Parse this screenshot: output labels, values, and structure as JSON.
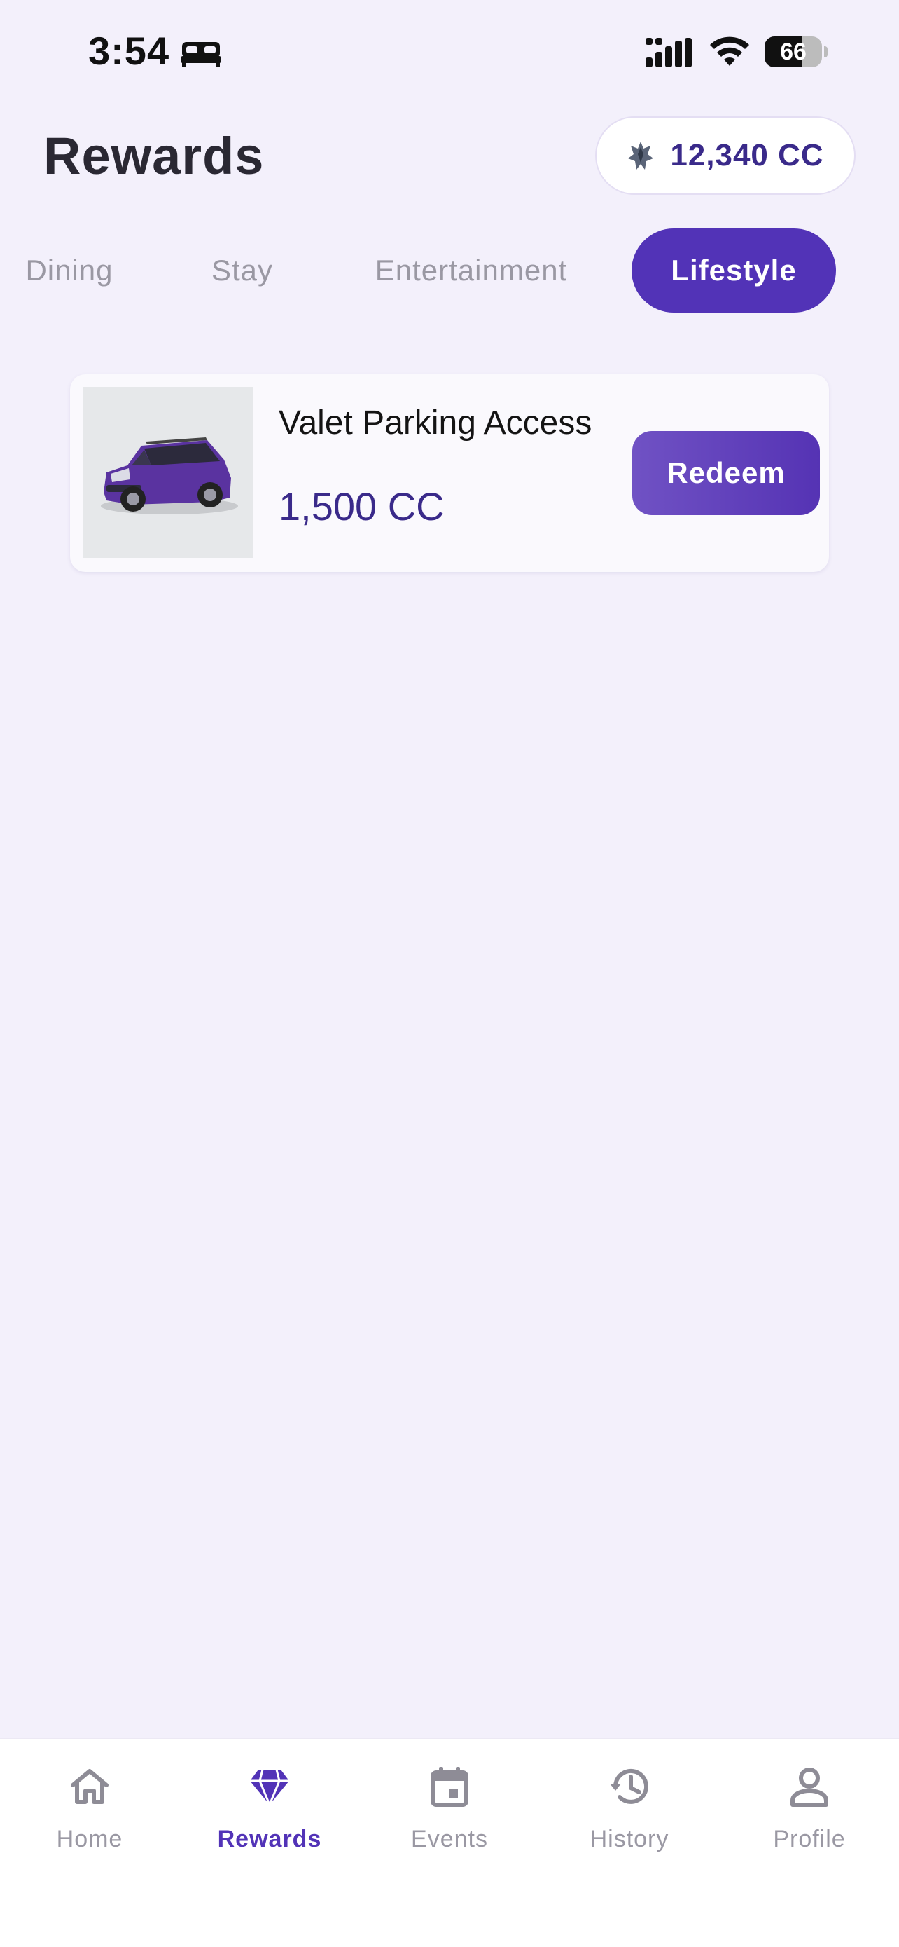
{
  "status_bar": {
    "time": "3:54",
    "battery": "66",
    "battery_level": 0.66,
    "icons": [
      "bed-icon",
      "signal-icon",
      "wifi-icon",
      "battery-icon"
    ]
  },
  "header": {
    "title": "Rewards",
    "balance": "12,340 CC",
    "balance_icon": "coin-icon"
  },
  "tabs": [
    {
      "label": "Dining",
      "active": false
    },
    {
      "label": "Stay",
      "active": false
    },
    {
      "label": "Entertainment",
      "active": false
    },
    {
      "label": "Lifestyle",
      "active": true
    }
  ],
  "rewards": [
    {
      "title": "Valet Parking Access",
      "cost": "1,500 CC",
      "image_icon": "car-icon",
      "action_label": "Redeem"
    }
  ],
  "bottom_nav": [
    {
      "label": "Home",
      "icon": "home-icon",
      "active": false
    },
    {
      "label": "Rewards",
      "icon": "diamond-icon",
      "active": true
    },
    {
      "label": "Events",
      "icon": "calendar-icon",
      "active": false
    },
    {
      "label": "History",
      "icon": "history-icon",
      "active": false
    },
    {
      "label": "Profile",
      "icon": "profile-icon",
      "active": false
    }
  ],
  "colors": {
    "background": "#f3f0fb",
    "accent": "#5233b7",
    "balance_text": "#3a2a8a",
    "inactive": "#9a98a3"
  }
}
